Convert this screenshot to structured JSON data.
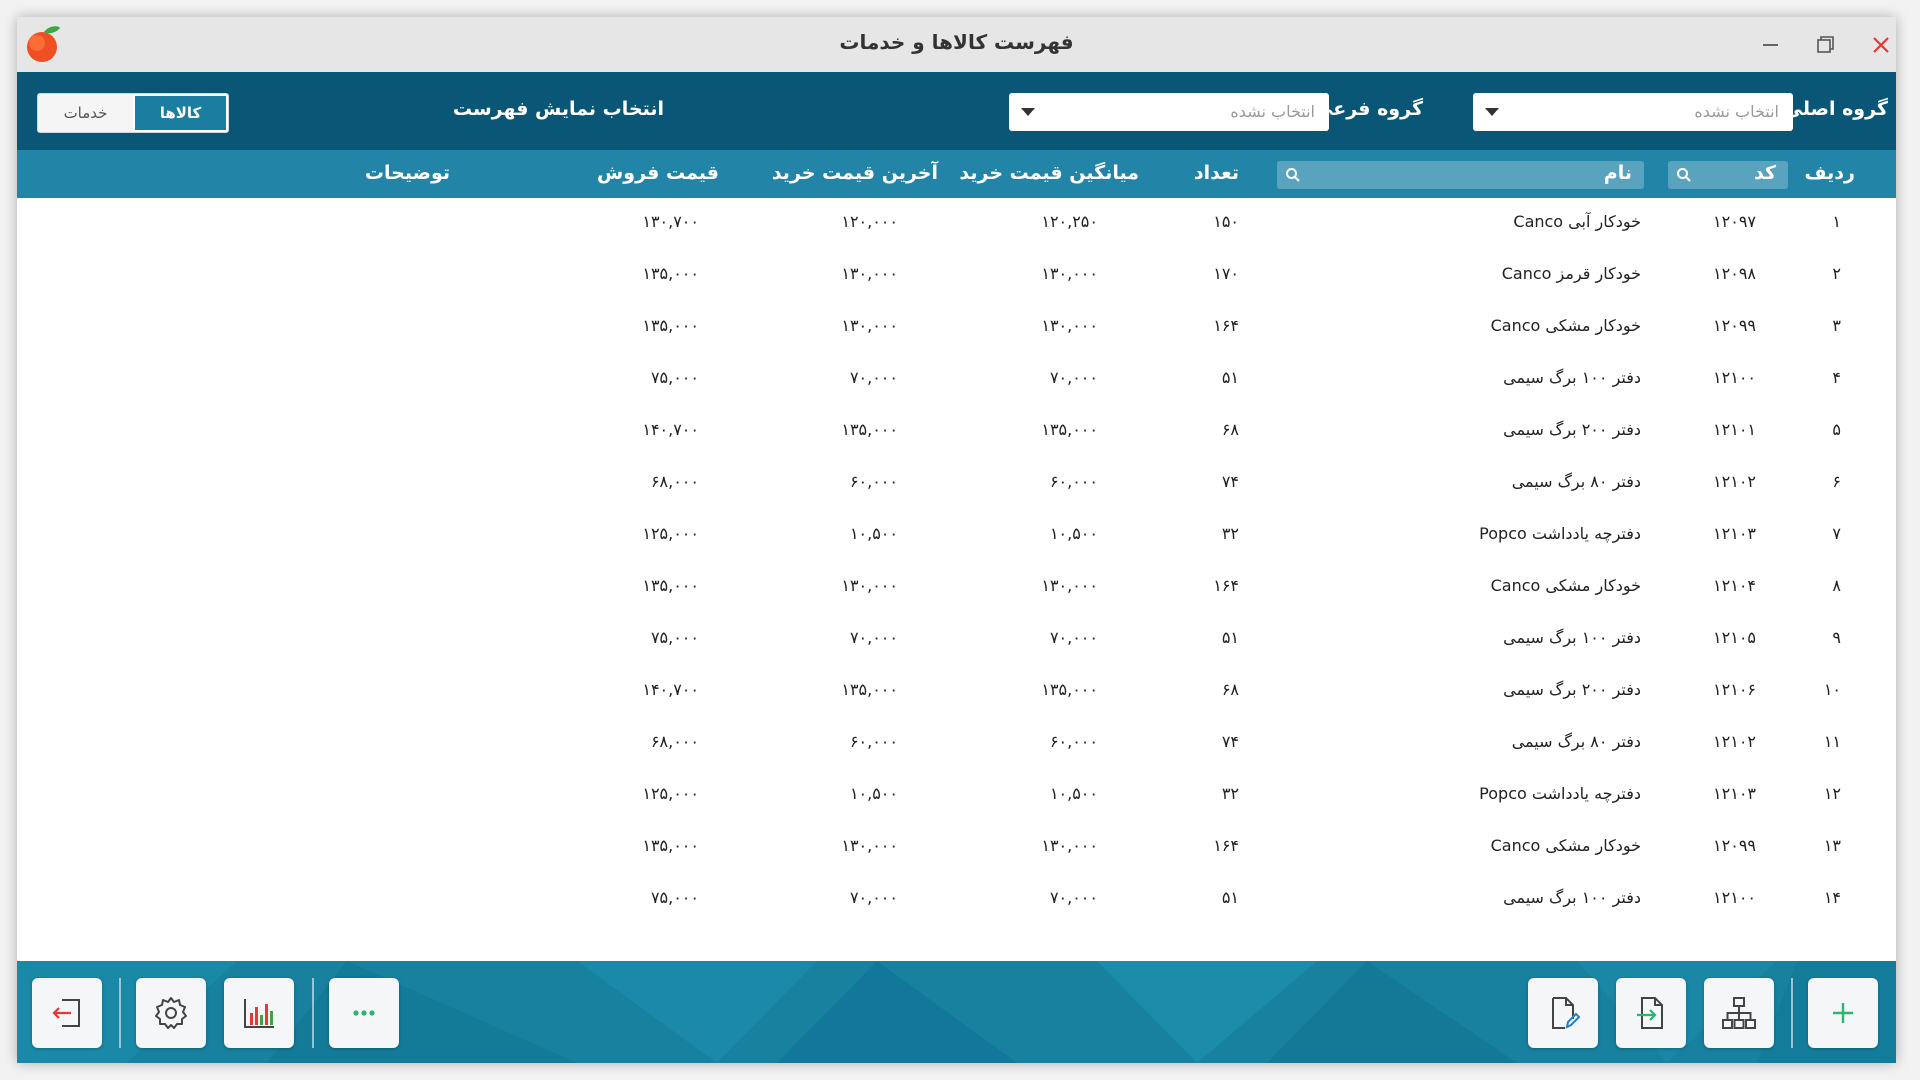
{
  "window": {
    "title": "فهرست کالاها و خدمات",
    "icons": {
      "logo": "peach-logo-icon",
      "close": "close-icon",
      "restore": "restore-icon",
      "minimize": "minimize-icon"
    }
  },
  "filters": {
    "main_group_label": "گروه اصلی",
    "main_group_value": "انتخاب نشده",
    "sub_group_label": "گروه فرعی",
    "sub_group_value": "انتخاب نشده",
    "display_mode_label": "انتخاب نمایش فهرست",
    "mode_goods": "کالاها",
    "mode_services": "خدمات",
    "selected_mode": "کالاها"
  },
  "table": {
    "headers": {
      "row": "ردیف",
      "code": "کد",
      "name": "نام",
      "qty": "تعداد",
      "avg_buy": "میانگین قیمت خرید",
      "last_buy": "آخرین قیمت خرید",
      "sell": "قیمت فروش",
      "desc": "توضیحات"
    },
    "rows": [
      {
        "row": "۱",
        "code": "۱۲۰۹۷",
        "name": "خودکار آبی Canco",
        "qty": "۱۵۰",
        "avg_buy": "۱۲۰,۲۵۰",
        "last_buy": "۱۲۰,۰۰۰",
        "sell": "۱۳۰,۷۰۰",
        "desc": ""
      },
      {
        "row": "۲",
        "code": "۱۲۰۹۸",
        "name": "خودکار قرمز Canco",
        "qty": "۱۷۰",
        "avg_buy": "۱۳۰,۰۰۰",
        "last_buy": "۱۳۰,۰۰۰",
        "sell": "۱۳۵,۰۰۰",
        "desc": ""
      },
      {
        "row": "۳",
        "code": "۱۲۰۹۹",
        "name": "خودکار مشکی Canco",
        "qty": "۱۶۴",
        "avg_buy": "۱۳۰,۰۰۰",
        "last_buy": "۱۳۰,۰۰۰",
        "sell": "۱۳۵,۰۰۰",
        "desc": ""
      },
      {
        "row": "۴",
        "code": "۱۲۱۰۰",
        "name": "دفتر ۱۰۰ برگ سیمی",
        "qty": "۵۱",
        "avg_buy": "۷۰,۰۰۰",
        "last_buy": "۷۰,۰۰۰",
        "sell": "۷۵,۰۰۰",
        "desc": ""
      },
      {
        "row": "۵",
        "code": "۱۲۱۰۱",
        "name": "دفتر ۲۰۰ برگ سیمی",
        "qty": "۶۸",
        "avg_buy": "۱۳۵,۰۰۰",
        "last_buy": "۱۳۵,۰۰۰",
        "sell": "۱۴۰,۷۰۰",
        "desc": ""
      },
      {
        "row": "۶",
        "code": "۱۲۱۰۲",
        "name": "دفتر ۸۰ برگ سیمی",
        "qty": "۷۴",
        "avg_buy": "۶۰,۰۰۰",
        "last_buy": "۶۰,۰۰۰",
        "sell": "۶۸,۰۰۰",
        "desc": ""
      },
      {
        "row": "۷",
        "code": "۱۲۱۰۳",
        "name": "دفترچه یادداشت Popco",
        "qty": "۳۲",
        "avg_buy": "۱۰,۵۰۰",
        "last_buy": "۱۰,۵۰۰",
        "sell": "۱۲۵,۰۰۰",
        "desc": ""
      },
      {
        "row": "۸",
        "code": "۱۲۱۰۴",
        "name": "خودکار مشکی Canco",
        "qty": "۱۶۴",
        "avg_buy": "۱۳۰,۰۰۰",
        "last_buy": "۱۳۰,۰۰۰",
        "sell": "۱۳۵,۰۰۰",
        "desc": ""
      },
      {
        "row": "۹",
        "code": "۱۲۱۰۵",
        "name": "دفتر ۱۰۰ برگ سیمی",
        "qty": "۵۱",
        "avg_buy": "۷۰,۰۰۰",
        "last_buy": "۷۰,۰۰۰",
        "sell": "۷۵,۰۰۰",
        "desc": ""
      },
      {
        "row": "۱۰",
        "code": "۱۲۱۰۶",
        "name": "دفتر ۲۰۰ برگ سیمی",
        "qty": "۶۸",
        "avg_buy": "۱۳۵,۰۰۰",
        "last_buy": "۱۳۵,۰۰۰",
        "sell": "۱۴۰,۷۰۰",
        "desc": ""
      },
      {
        "row": "۱۱",
        "code": "۱۲۱۰۲",
        "name": "دفتر ۸۰ برگ سیمی",
        "qty": "۷۴",
        "avg_buy": "۶۰,۰۰۰",
        "last_buy": "۶۰,۰۰۰",
        "sell": "۶۸,۰۰۰",
        "desc": ""
      },
      {
        "row": "۱۲",
        "code": "۱۲۱۰۳",
        "name": "دفترچه یادداشت Popco",
        "qty": "۳۲",
        "avg_buy": "۱۰,۵۰۰",
        "last_buy": "۱۰,۵۰۰",
        "sell": "۱۲۵,۰۰۰",
        "desc": ""
      },
      {
        "row": "۱۳",
        "code": "۱۲۰۹۹",
        "name": "خودکار مشکی Canco",
        "qty": "۱۶۴",
        "avg_buy": "۱۳۰,۰۰۰",
        "last_buy": "۱۳۰,۰۰۰",
        "sell": "۱۳۵,۰۰۰",
        "desc": ""
      },
      {
        "row": "۱۴",
        "code": "۱۲۱۰۰",
        "name": "دفتر ۱۰۰ برگ سیمی",
        "qty": "۵۱",
        "avg_buy": "۷۰,۰۰۰",
        "last_buy": "۷۰,۰۰۰",
        "sell": "۷۵,۰۰۰",
        "desc": ""
      }
    ]
  },
  "toolbar": {
    "buttons_left": [
      "exit-icon",
      "settings-icon",
      "chart-icon",
      "more-icon"
    ],
    "buttons_right": [
      "edit-document-icon",
      "import-icon",
      "hierarchy-icon",
      "add-icon"
    ]
  },
  "colors": {
    "filter_bar": "#0a5677",
    "table_header": "#2285a8",
    "toolbar": "#17819f",
    "accent_green": "#2bb573",
    "chart_red": "#e53935",
    "chart_green": "#43a047"
  }
}
